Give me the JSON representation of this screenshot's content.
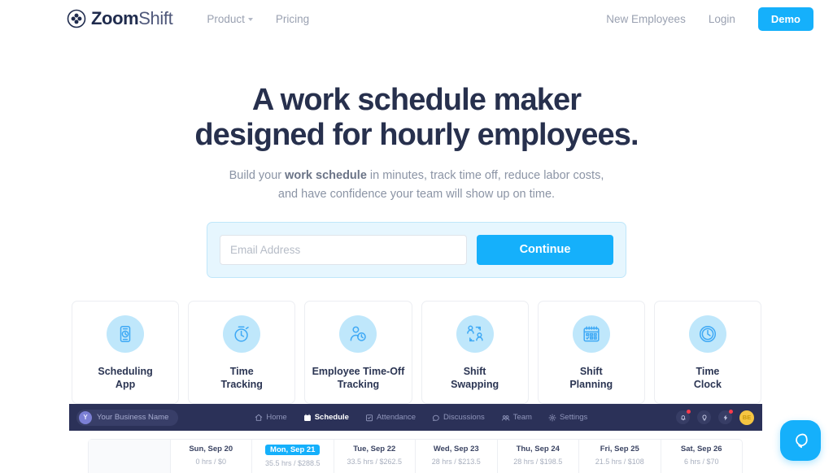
{
  "header": {
    "brand": {
      "name_bold": "Zoom",
      "name_light": "Shift",
      "logo_icon": "zoomshift-clover-logo"
    },
    "nav": [
      {
        "label": "Product",
        "has_caret": true
      },
      {
        "label": "Pricing",
        "has_caret": false
      }
    ],
    "nav_right": [
      {
        "label": "New Employees"
      },
      {
        "label": "Login"
      }
    ],
    "demo_button": "Demo"
  },
  "hero": {
    "heading": "A work schedule maker designed for hourly employees.",
    "sub_part1": "Build your ",
    "sub_bold": "work schedule",
    "sub_part2": " in minutes, track time off, reduce labor costs, and have confidence your team will show up on time."
  },
  "signup": {
    "email_placeholder": "Email Address",
    "email_value": "",
    "continue_label": "Continue"
  },
  "features": [
    {
      "label": "Scheduling\nApp",
      "icon": "mobile-clock-icon"
    },
    {
      "label": "Time\nTracking",
      "icon": "stopwatch-icon"
    },
    {
      "label": "Employee Time-Off\nTracking",
      "icon": "person-clock-icon"
    },
    {
      "label": "Shift\nSwapping",
      "icon": "people-swap-icon"
    },
    {
      "label": "Shift\nPlanning",
      "icon": "calendar-icon"
    },
    {
      "label": "Time\nClock",
      "icon": "wall-clock-icon"
    }
  ],
  "app_preview": {
    "business_initial": "Y",
    "business_name": "Your Business Name",
    "nav": [
      {
        "label": "Home",
        "icon": "home-icon",
        "active": false
      },
      {
        "label": "Schedule",
        "icon": "calendar-icon",
        "active": true
      },
      {
        "label": "Attendance",
        "icon": "checklist-icon",
        "active": false
      },
      {
        "label": "Discussions",
        "icon": "chat-icon",
        "active": false
      },
      {
        "label": "Team",
        "icon": "team-icon",
        "active": false
      },
      {
        "label": "Settings",
        "icon": "gear-icon",
        "active": false
      }
    ],
    "actions": [
      {
        "icon": "bell-icon",
        "badge": true
      },
      {
        "icon": "lightbulb-icon",
        "badge": false
      },
      {
        "icon": "bolt-icon",
        "badge": true
      }
    ],
    "user_initials": "BE",
    "schedule": {
      "columns": [
        {
          "date": "",
          "summary": "",
          "today": false,
          "first": true
        },
        {
          "date": "Sun, Sep 20",
          "summary": "0 hrs / $0",
          "today": false,
          "first": false
        },
        {
          "date": "Mon, Sep 21",
          "summary": "35.5 hrs / $288.5",
          "today": true,
          "first": false
        },
        {
          "date": "Tue, Sep 22",
          "summary": "33.5 hrs / $262.5",
          "today": false,
          "first": false
        },
        {
          "date": "Wed, Sep 23",
          "summary": "28 hrs / $213.5",
          "today": false,
          "first": false
        },
        {
          "date": "Thu, Sep 24",
          "summary": "28 hrs / $198.5",
          "today": false,
          "first": false
        },
        {
          "date": "Fri, Sep 25",
          "summary": "21.5 hrs / $108",
          "today": false,
          "first": false
        },
        {
          "date": "Sat, Sep 26",
          "summary": "6 hrs / $70",
          "today": false,
          "first": false
        }
      ]
    }
  },
  "chat": {
    "icon": "chat-bubble-icon"
  },
  "colors": {
    "accent_blue": "#15b0fb",
    "icon_bg": "#bfe7fb",
    "dark_navy": "#2b3158",
    "heading": "#27304d",
    "muted_text": "#8b94a5",
    "badge_red": "#fb3b4b",
    "avatar_yellow": "#f5c542"
  }
}
